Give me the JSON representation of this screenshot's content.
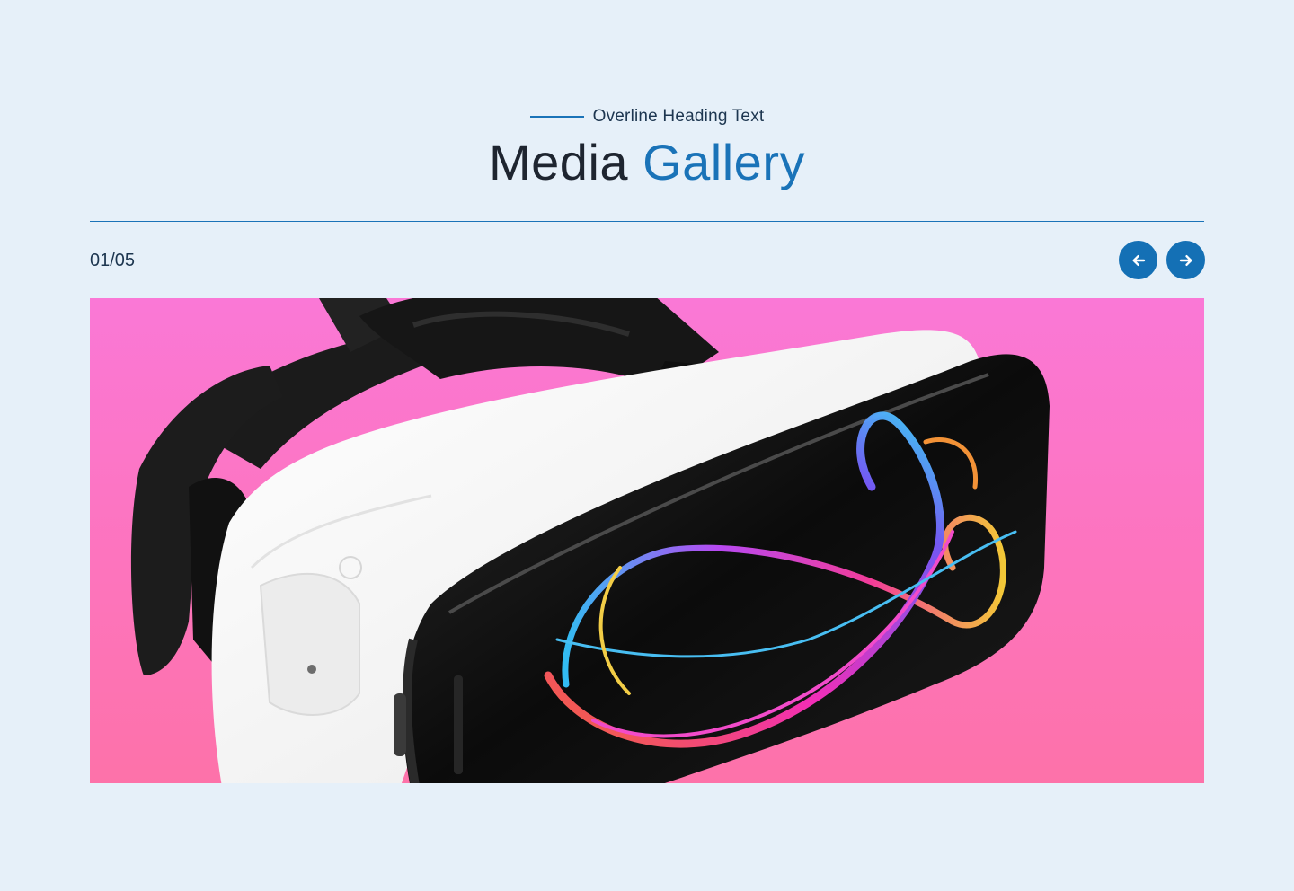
{
  "header": {
    "overline": "Overline Heading Text",
    "title_dark": "Media",
    "title_accent": "Gallery"
  },
  "gallery": {
    "counter": "01/05",
    "current_slide": 1,
    "total_slides": 5,
    "prev_icon": "arrow-left-icon",
    "next_icon": "arrow-right-icon",
    "image_subject": "vr-headset-photo"
  },
  "colors": {
    "background": "#e6f0f9",
    "accent": "#1a73b8",
    "button": "#1470b5",
    "image_bg": "#fd74bd"
  }
}
